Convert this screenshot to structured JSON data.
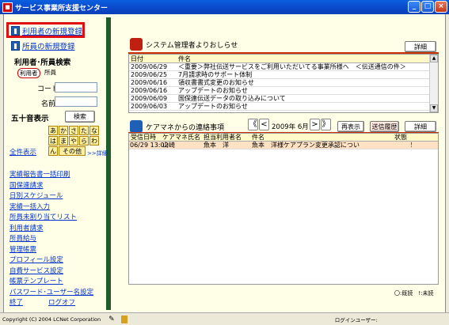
{
  "window": {
    "title": "サービス事業所支援センター",
    "min": "_",
    "max": "□",
    "close": "×"
  },
  "sidebar": {
    "new_user": "利用者の新規登録",
    "new_staff": "所員の新規登録",
    "search_title": "利用者･所員検索",
    "radio_user": "利用者",
    "radio_staff": "所員",
    "code_label": "コード",
    "name_label": "名前",
    "kana_title": "五十音表示",
    "search_btn": "検索",
    "kana_row1": [
      "あ",
      "か",
      "さ",
      "た",
      "な"
    ],
    "kana_row2": [
      "は",
      "ま",
      "や",
      "ら",
      "わ"
    ],
    "kana_n": "ん",
    "kana_other": "その他",
    "detail_link": ">>詳細",
    "show_all": "全件表示",
    "menu": [
      "実績報告書一括印刷",
      "国保連請求",
      "日別スケジュール",
      "実績一括入力",
      "所員未割り当てリスト",
      "利用者請求",
      "所員給与",
      "管理帳票",
      "プロフィール設定",
      "自費サービス設定",
      "帳票テンプレート",
      "パスワード･ユーザー名設定"
    ],
    "exit": "終了",
    "logoff": "ログオフ"
  },
  "notices": {
    "title": "システム管理者よりおしらせ",
    "detail_btn": "詳細",
    "col_date": "日付",
    "col_title": "件名",
    "rows": [
      {
        "date": "2009/06/29",
        "title": "＜重要＞弊社伝送サービスをご利用いただいてる事業所様へ　＜伝送通信の件＞"
      },
      {
        "date": "2009/06/25",
        "title": "7月請求時のサポート体制"
      },
      {
        "date": "2009/06/16",
        "title": "領収書書式変更のお知らせ"
      },
      {
        "date": "2009/06/16",
        "title": "アップデートのお知らせ"
      },
      {
        "date": "2009/06/09",
        "title": "国保連伝送データの取り込みについて"
      },
      {
        "date": "2009/06/03",
        "title": "アップデートのお知らせ"
      }
    ]
  },
  "contacts": {
    "title": "ケアマネからの連絡事項",
    "first": "《",
    "prev": "<",
    "month": "2009年 6月",
    "next": ">",
    "last": "》",
    "redisplay": "再表示",
    "history": "送信履歴",
    "detail_btn": "詳細",
    "cols": [
      "受信日時",
      "ケアマネ氏名",
      "担当利用者名",
      "件名",
      "状態"
    ],
    "rows": [
      {
        "time": "06/29 13:02",
        "cm": "山崎",
        "user": "魚本　洋",
        "subject": "魚本　洋様ケアプラン変更承認につい",
        "state": "！"
      }
    ],
    "legend": "〇:既読　!:未読"
  },
  "status": {
    "copyright": "Copyright (C) 2004 LCNet Corporation",
    "login": "ログインユーザー:"
  },
  "colors": {
    "accent": "#CC3300",
    "title_blue": "#0A5FE0",
    "link": "#0033CC",
    "sidebar_bar": "#1E5C2A"
  }
}
